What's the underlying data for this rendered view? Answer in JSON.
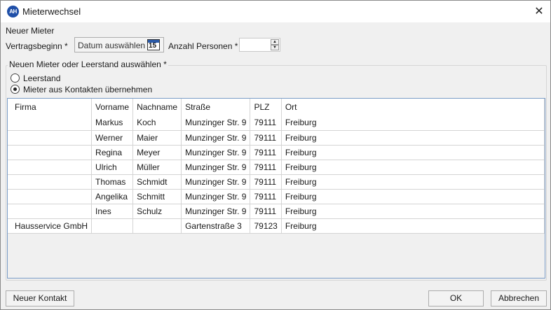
{
  "window": {
    "title": "Mieterwechsel",
    "app_icon_text": "AH",
    "close_symbol": "✕"
  },
  "form": {
    "section_label": "Neuer Mieter",
    "vertragsbeginn_label": "Vertragsbeginn *",
    "date_placeholder": "Datum auswählen",
    "calendar_day": "15",
    "persons_label": "Anzahl Personen *",
    "persons_value": ""
  },
  "group": {
    "label": "Neuen Mieter oder Leerstand auswählen *",
    "options": [
      {
        "label": "Leerstand",
        "checked": false
      },
      {
        "label": "Mieter aus Kontakten übernehmen",
        "checked": true
      }
    ]
  },
  "table": {
    "columns": [
      "Firma",
      "Vorname",
      "Nachname",
      "Straße",
      "PLZ",
      "Ort"
    ],
    "rows": [
      [
        "",
        "Markus",
        "Koch",
        "Munzinger Str. 9",
        "79111",
        "Freiburg"
      ],
      [
        "",
        "Werner",
        "Maier",
        "Munzinger Str. 9",
        "79111",
        "Freiburg"
      ],
      [
        "",
        "Regina",
        "Meyer",
        "Munzinger Str. 9",
        "79111",
        "Freiburg"
      ],
      [
        "",
        "Ulrich",
        "Müller",
        "Munzinger Str. 9",
        "79111",
        "Freiburg"
      ],
      [
        "",
        "Thomas",
        "Schmidt",
        "Munzinger Str. 9",
        "79111",
        "Freiburg"
      ],
      [
        "",
        "Angelika",
        "Schmitt",
        "Munzinger Str. 9",
        "79111",
        "Freiburg"
      ],
      [
        "",
        "Ines",
        "Schulz",
        "Munzinger Str. 9",
        "79111",
        "Freiburg"
      ],
      [
        "Hausservice GmbH",
        "",
        "",
        "Gartenstraße 3",
        "79123",
        "Freiburg"
      ]
    ]
  },
  "buttons": {
    "new_contact": "Neuer Kontakt",
    "ok": "OK",
    "cancel": "Abbrechen"
  },
  "colors": {
    "app_icon": "#1f4fa8",
    "table_border": "#7a9cc6"
  }
}
